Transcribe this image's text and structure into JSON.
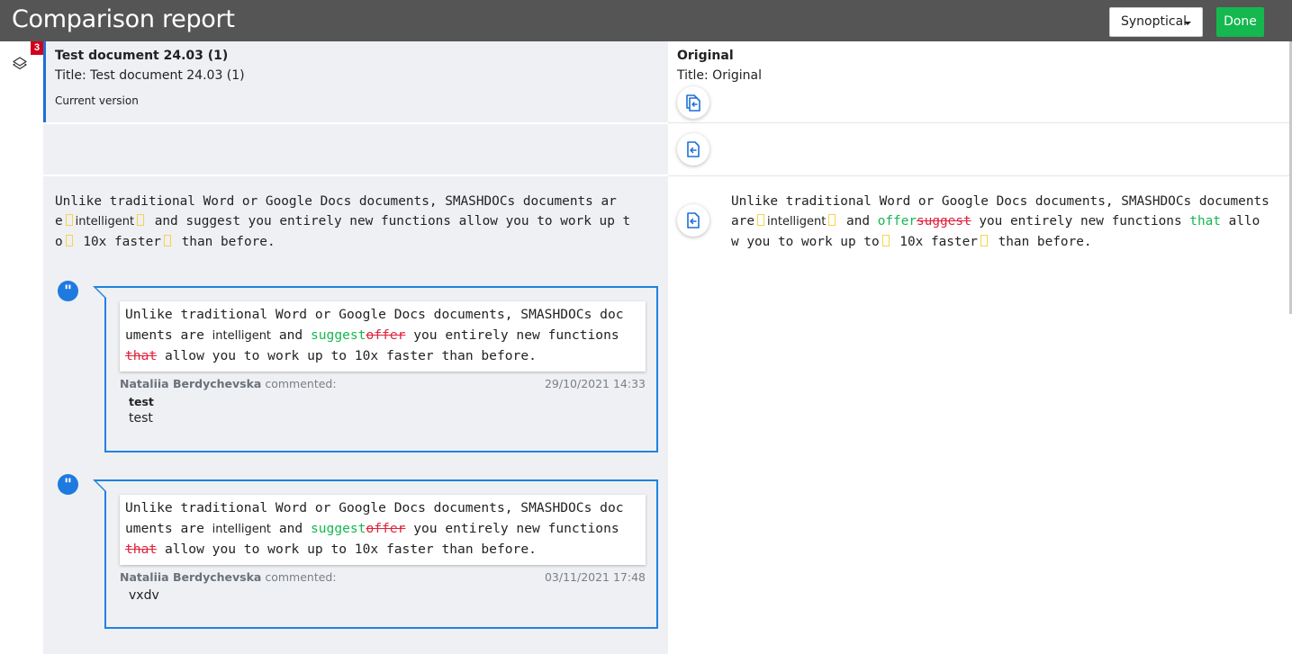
{
  "header": {
    "title": "Comparison report",
    "view_mode": "Synoptical",
    "done_label": "Done"
  },
  "left_rail": {
    "badge_count": "3"
  },
  "current_doc": {
    "name": "Test document 24.03 (1)",
    "title_line": "Title: Test document 24.03 (1)",
    "version_label": "Current version"
  },
  "original_doc": {
    "name": "Original",
    "title_line": "Title: Original"
  },
  "left_paragraph": {
    "p1": "Unlike traditional Word or Google Docs documents, SMASHDOCs documents ar",
    "p2": "e",
    "p3": "intelligent",
    "p4": " and suggest you entirely new functions allow you to work up t",
    "p5": "o",
    "p6": " 10x faster",
    "p7": " than before."
  },
  "right_paragraph": {
    "p1": "Unlike traditional Word or Google Docs documents, SMASHDOCs documents",
    "p2": "are",
    "p3": "intelligent",
    "p4": " and ",
    "ins1": "offer",
    "del1": "suggest",
    "p5": " you entirely new functions ",
    "ins2": "that",
    "p6": " allo",
    "p7": "w you to work up to",
    "p8": " 10x faster",
    "p9": " than before."
  },
  "comments": [
    {
      "q1": "Unlike traditional Word or Google Docs documents, SMASHDOCs doc",
      "q2": "uments are ",
      "q3": "intelligent",
      "q4": " and ",
      "ins": "suggest",
      "del": "offer",
      "q5": " you entirely new functions",
      "del2": "that",
      "q6": " allow you to work up to 10x faster than before.",
      "author": "Nataliia Berdychevska",
      "action": "commented:",
      "date": "29/10/2021 14:33",
      "subject": "test",
      "body": "test"
    },
    {
      "q1": "Unlike traditional Word or Google Docs documents, SMASHDOCs doc",
      "q2": "uments are ",
      "q3": "intelligent",
      "q4": " and ",
      "ins": "suggest",
      "del": "offer",
      "q5": " you entirely new functions",
      "del2": "that",
      "q6": " allow you to work up to 10x faster than before.",
      "author": "Nataliia Berdychevska",
      "action": "commented:",
      "date": "03/11/2021 17:48",
      "body": "vxdv"
    }
  ],
  "colors": {
    "topbar": "#555555",
    "done": "#14b84f",
    "accent": "#1f82e0",
    "insert": "#14b84f",
    "delete": "#e0213a",
    "badge": "#d0021b"
  }
}
